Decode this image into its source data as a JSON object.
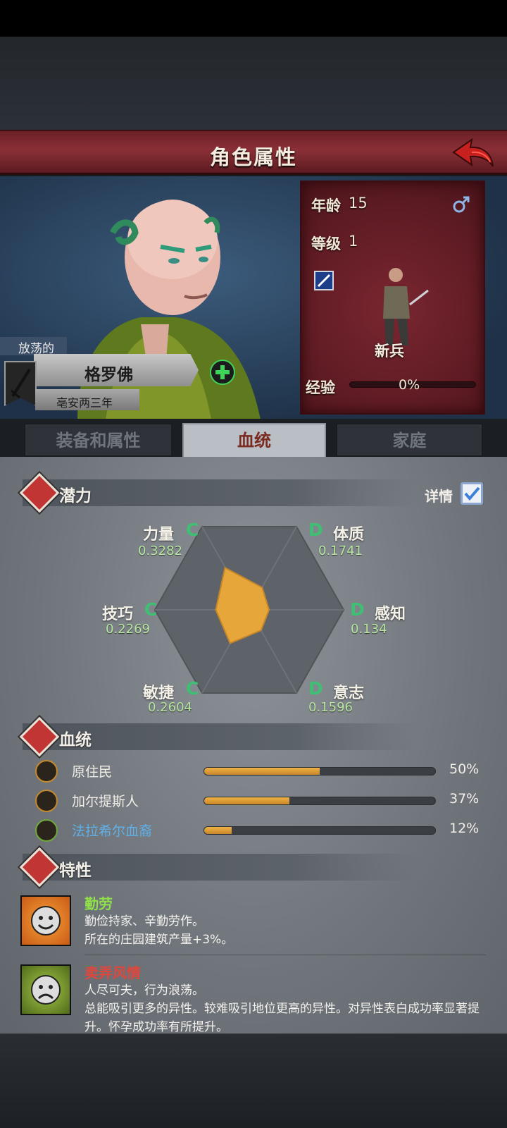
{
  "header": {
    "title": "角色属性"
  },
  "character": {
    "trait_prefix": "放荡的",
    "name": "格罗佛",
    "era": "亳安两三年"
  },
  "info": {
    "age_label": "年龄",
    "age_value": "15",
    "level_label": "等级",
    "level_value": "1",
    "rank": "新兵",
    "xp_label": "经验",
    "xp_value": "0%",
    "xp_fraction": 0
  },
  "tabs": [
    {
      "label": "装备和属性",
      "active": false
    },
    {
      "label": "血统",
      "active": true
    },
    {
      "label": "家庭",
      "active": false
    }
  ],
  "potential": {
    "title": "潜力",
    "detail_label": "详情",
    "detail_checked": true,
    "attributes": [
      {
        "name": "力量",
        "grade": "C",
        "value": "0.3282"
      },
      {
        "name": "体质",
        "grade": "D",
        "value": "0.1741"
      },
      {
        "name": "技巧",
        "grade": "C",
        "value": "0.2269"
      },
      {
        "name": "感知",
        "grade": "D",
        "value": "0.134"
      },
      {
        "name": "敏捷",
        "grade": "C",
        "value": "0.2604"
      },
      {
        "name": "意志",
        "grade": "D",
        "value": "0.1596"
      }
    ]
  },
  "bloodline": {
    "title": "血统",
    "items": [
      {
        "name": "原住民",
        "percent": "50%",
        "fraction": 0.5,
        "icon": "leaf-icon"
      },
      {
        "name": "加尔提斯人",
        "percent": "37%",
        "fraction": 0.37,
        "icon": "beast-icon"
      },
      {
        "name": "法拉希尔血裔",
        "percent": "12%",
        "fraction": 0.12,
        "icon": "tree-icon"
      }
    ]
  },
  "traits": {
    "title": "特性",
    "items": [
      {
        "name": "勤劳",
        "name_color": "#8fe04a",
        "desc1": "勤俭持家、辛勤劳作。",
        "desc2": "所在的庄园建筑产量+3%。",
        "icon": "happy-face-icon"
      },
      {
        "name": "卖弄风情",
        "name_color": "#e0473c",
        "desc1": "人尽可夫，行为浪荡。",
        "desc2": "总能吸引更多的异性。较难吸引地位更高的异性。对异性表白成功率显著提升。怀孕成功率有所提升。",
        "icon": "sad-face-icon"
      }
    ]
  },
  "colors": {
    "accent_red": "#8a2f36",
    "grade_green": "#3fbf73",
    "bar_orange": "#e3a43c"
  }
}
